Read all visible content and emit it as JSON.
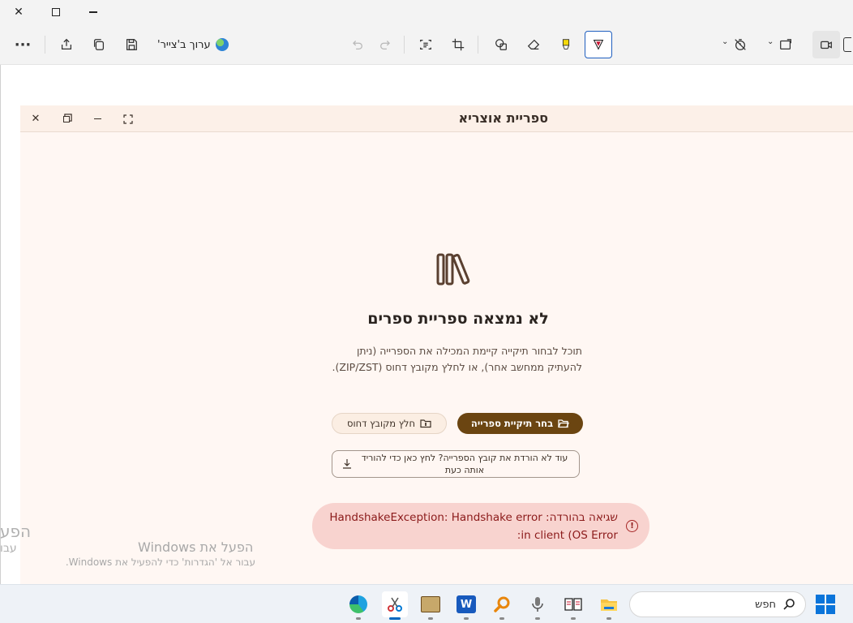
{
  "snipping_tool": {
    "edit_in_paint_label": "ערוך ב'צייר'",
    "more_label": "···"
  },
  "otzaria": {
    "window_title": "ספריית אוצריא",
    "heading": "לא נמצאה ספריית ספרים",
    "description": "תוכל לבחור תיקייה קיימת המכילה את הספרייה (ניתן להעתיק ממחשב אחר), או לחלץ מקובץ דחוס (ZIP/ZST).",
    "choose_folder_button": "בחר תיקיית ספרייה",
    "extract_button": "חלץ מקובץ דחוס",
    "download_button": "עוד לא הורדת את קובץ הספרייה? לחץ כאן כדי להוריד אותה כעת",
    "error_message": "שגיאה בהורדה: HandshakeException: Handshake error in client (OS Error:",
    "accent_color": "#6b4511",
    "error_color": "#8b1a1a"
  },
  "watermark": {
    "title": "הפעל את Windows",
    "subtitle": "עבור אל 'הגדרות' כדי להפעיל את Windows.",
    "left_title_fragment": "הפע",
    "left_sub_fragment": "עבו"
  },
  "taskbar": {
    "search_placeholder": "חפש",
    "apps": [
      "edge-icon",
      "snipping-tool-icon",
      "otzaria-icon",
      "word-icon",
      "search-app-icon",
      "microphone-icon",
      "reader-icon",
      "file-explorer-icon"
    ]
  }
}
